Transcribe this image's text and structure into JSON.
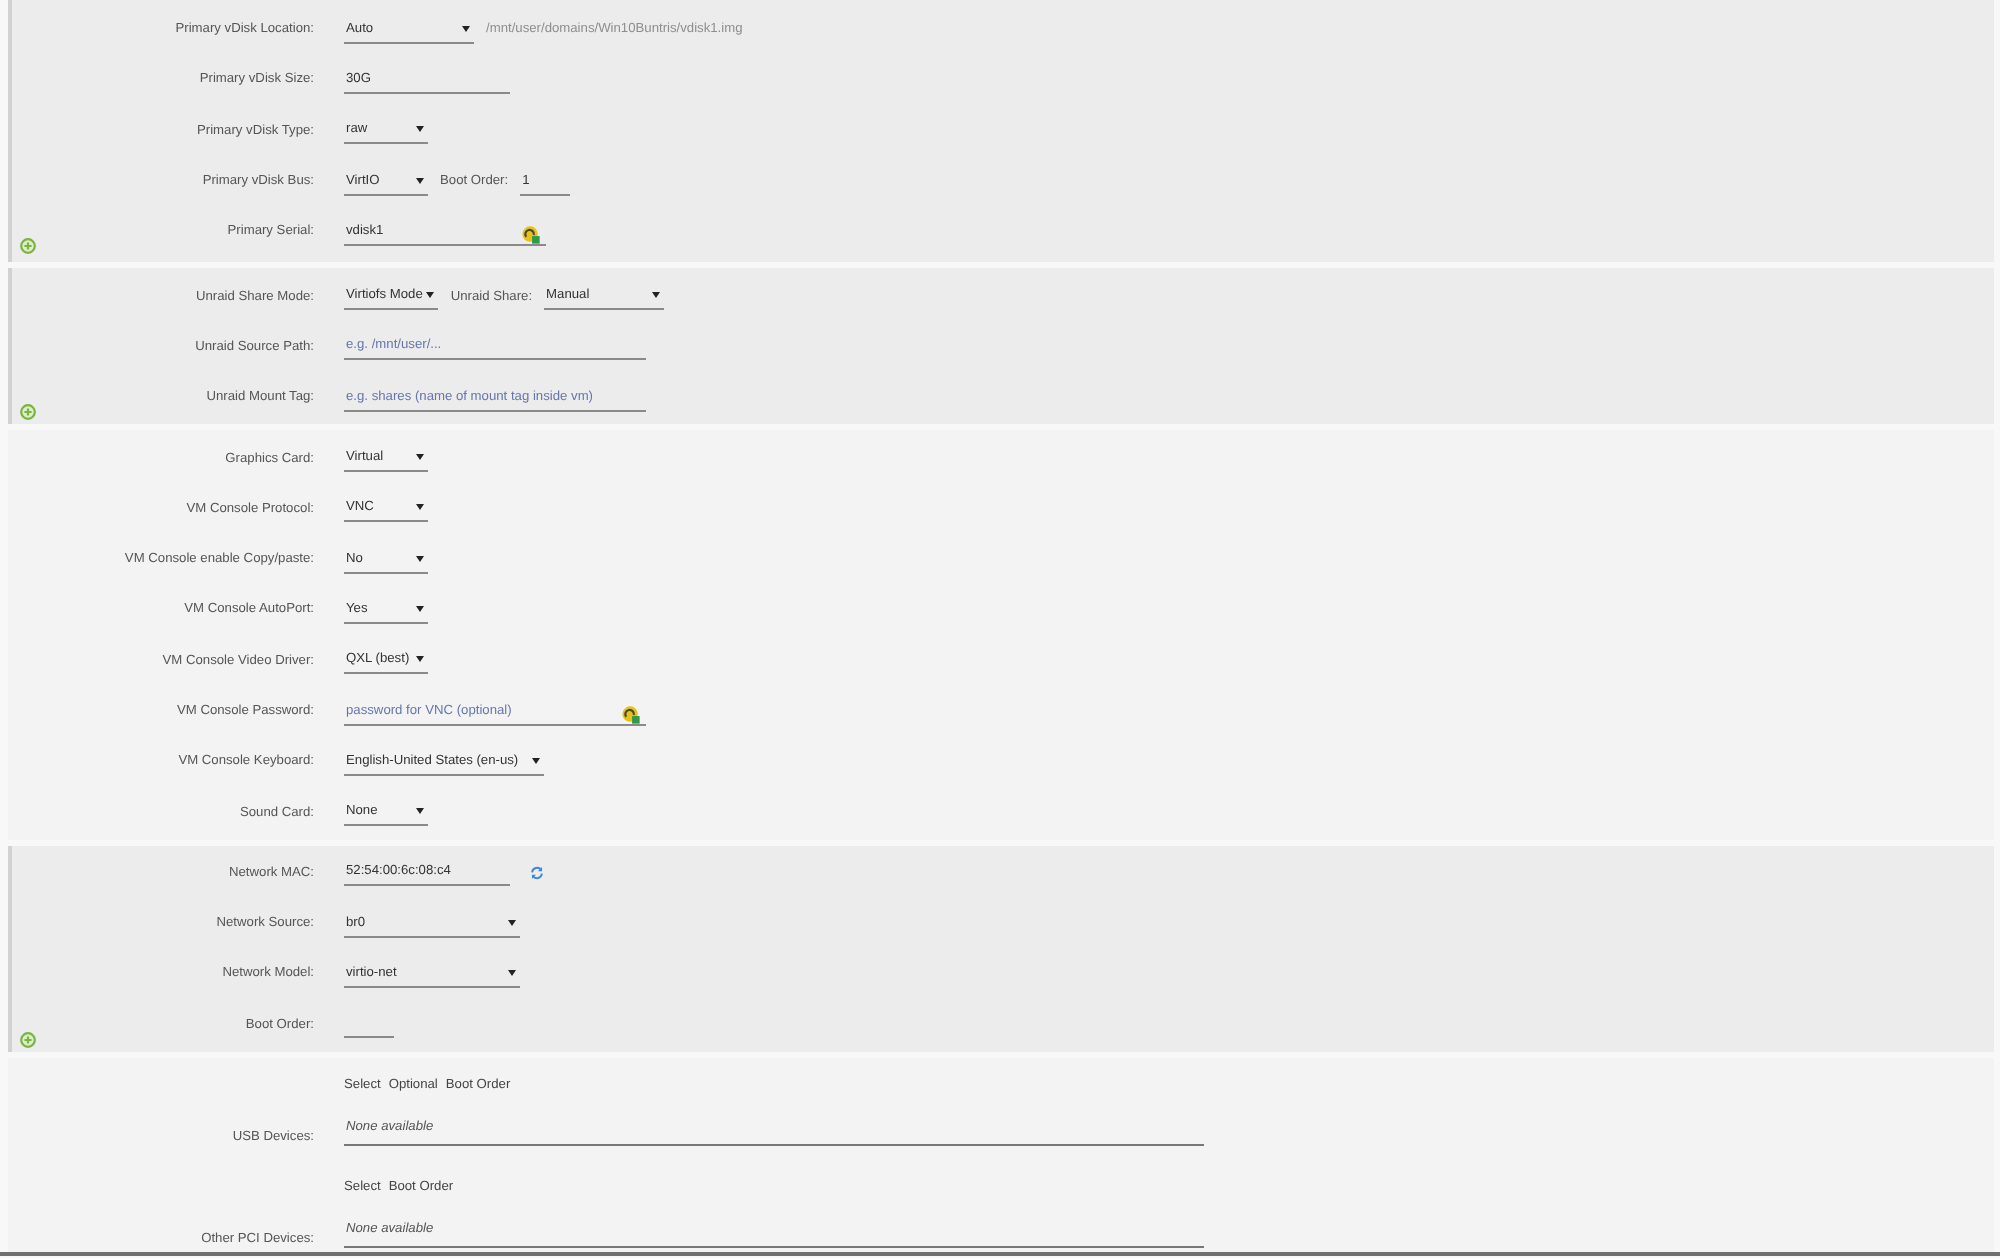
{
  "sections": [
    {
      "shaded": true,
      "add_button": true,
      "rows": [
        {
          "label": "Primary vDisk Location:",
          "controls": [
            {
              "kind": "select",
              "value": "Auto"
            },
            {
              "kind": "note",
              "text": "/mnt/user/domains/Win10Buntris/vdisk1.img"
            }
          ]
        },
        {
          "label": "Primary vDisk Size:",
          "controls": [
            {
              "kind": "input",
              "value": "30G"
            }
          ]
        },
        {
          "label": "Primary vDisk Type:",
          "controls": [
            {
              "kind": "select",
              "value": "raw"
            }
          ]
        },
        {
          "label": "Primary vDisk Bus:",
          "controls": [
            {
              "kind": "select",
              "value": "VirtIO"
            },
            {
              "kind": "label",
              "text": "Boot Order:"
            },
            {
              "kind": "input",
              "value": "1"
            }
          ]
        },
        {
          "label": "Primary Serial:",
          "controls": [
            {
              "kind": "input",
              "value": "vdisk1",
              "generator": true
            }
          ]
        }
      ]
    },
    {
      "shaded": true,
      "add_button": true,
      "rows": [
        {
          "label": "Unraid Share Mode:",
          "controls": [
            {
              "kind": "select",
              "value": "Virtiofs Mode"
            },
            {
              "kind": "label",
              "text": "Unraid Share:"
            },
            {
              "kind": "select",
              "value": "Manual"
            }
          ]
        },
        {
          "label": "Unraid Source Path:",
          "controls": [
            {
              "kind": "input",
              "placeholder": "e.g. /mnt/user/..."
            }
          ]
        },
        {
          "label": "Unraid Mount Tag:",
          "controls": [
            {
              "kind": "input",
              "placeholder": "e.g. shares (name of mount tag inside vm)"
            }
          ]
        }
      ]
    },
    {
      "shaded": false,
      "add_button": false,
      "rows": [
        {
          "label": "Graphics Card:",
          "controls": [
            {
              "kind": "select",
              "value": "Virtual"
            }
          ]
        },
        {
          "label": "VM Console Protocol:",
          "controls": [
            {
              "kind": "select",
              "value": "VNC"
            }
          ]
        },
        {
          "label": "VM Console enable Copy/paste:",
          "controls": [
            {
              "kind": "select",
              "value": "No"
            }
          ]
        },
        {
          "label": "VM Console AutoPort:",
          "controls": [
            {
              "kind": "select",
              "value": "Yes"
            }
          ]
        },
        {
          "label": "VM Console Video Driver:",
          "controls": [
            {
              "kind": "select",
              "value": "QXL (best)"
            }
          ]
        },
        {
          "label": "VM Console Password:",
          "controls": [
            {
              "kind": "input",
              "placeholder": "password for VNC (optional)",
              "generator": true
            }
          ]
        },
        {
          "label": "VM Console Keyboard:",
          "controls": [
            {
              "kind": "select",
              "value": "English-United States (en-us)"
            }
          ]
        },
        {
          "label": "Sound Card:",
          "controls": [
            {
              "kind": "select",
              "value": "None"
            }
          ]
        }
      ]
    },
    {
      "shaded": true,
      "add_button": true,
      "rows": [
        {
          "label": "Network MAC:",
          "controls": [
            {
              "kind": "input",
              "value": "52:54:00:6c:08:c4"
            },
            {
              "kind": "refresh"
            }
          ]
        },
        {
          "label": "Network Source:",
          "controls": [
            {
              "kind": "select",
              "value": "br0"
            }
          ]
        },
        {
          "label": "Network Model:",
          "controls": [
            {
              "kind": "select",
              "value": "virtio-net"
            }
          ]
        },
        {
          "label": "Boot Order:",
          "controls": [
            {
              "kind": "input"
            }
          ]
        }
      ]
    }
  ],
  "device_lists": [
    {
      "label": "USB Devices:",
      "headers": [
        "Select",
        "Optional",
        "Boot Order"
      ],
      "empty_text": "None available"
    },
    {
      "label": "Other PCI Devices:",
      "headers": [
        "Select",
        "Boot Order"
      ],
      "empty_text": "None available"
    }
  ]
}
